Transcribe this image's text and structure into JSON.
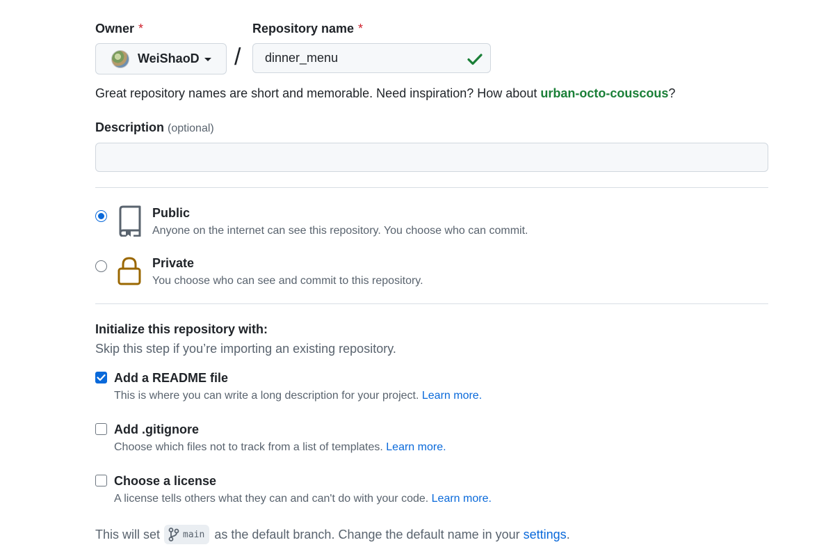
{
  "owner": {
    "label": "Owner",
    "required_mark": "*",
    "name": "WeiShaoD"
  },
  "separator": "/",
  "repo": {
    "label": "Repository name",
    "required_mark": "*",
    "value": "dinner_menu"
  },
  "hint": {
    "text": "Great repository names are short and memorable. Need inspiration? How about ",
    "suggestion": "urban-octo-couscous",
    "suffix": "?"
  },
  "description": {
    "label": "Description",
    "optional": "(optional)",
    "value": ""
  },
  "visibility": {
    "selected": "public",
    "options": [
      {
        "id": "public",
        "title": "Public",
        "desc": "Anyone on the internet can see this repository. You choose who can commit.",
        "icon": "repo-icon"
      },
      {
        "id": "private",
        "title": "Private",
        "desc": "You choose who can see and commit to this repository.",
        "icon": "lock-icon"
      }
    ]
  },
  "init": {
    "title": "Initialize this repository with:",
    "subtitle": "Skip this step if you’re importing an existing repository.",
    "items": [
      {
        "title": "Add a README file",
        "checked": true,
        "desc": "This is where you can write a long description for your project.",
        "link": "Learn more."
      },
      {
        "title": "Add .gitignore",
        "checked": false,
        "desc": "Choose which files not to track from a list of templates.",
        "link": "Learn more."
      },
      {
        "title": "Choose a license",
        "checked": false,
        "desc": "A license tells others what they can and can't do with your code.",
        "link": "Learn more."
      }
    ]
  },
  "branch": {
    "prefix": "This will set",
    "name": "main",
    "middle": "as the default branch. Change the default name in your",
    "link": "settings",
    "suffix": "."
  },
  "colors": {
    "accent": "#0969da",
    "success": "#1a7f37",
    "lock": "#9a6700",
    "required": "#cf222e"
  }
}
